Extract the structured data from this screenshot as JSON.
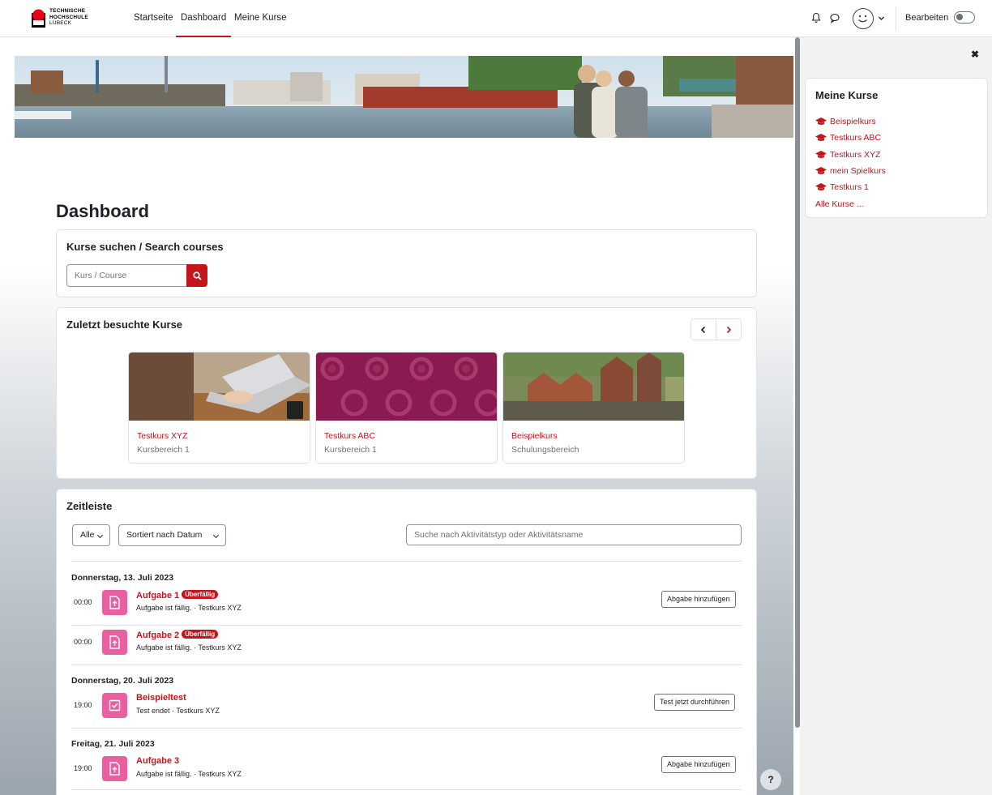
{
  "header": {
    "logo": {
      "line1": "TECHNISCHE",
      "line2": "HOCHSCHULE",
      "line3": "LÜBECK"
    },
    "nav": [
      "Startseite",
      "Dashboard",
      "Meine Kurse"
    ],
    "active_nav": "Dashboard",
    "edit_label": "Bearbeiten",
    "icons": [
      "bell-icon",
      "chat-icon",
      "user-avatar",
      "chevron-down-icon"
    ]
  },
  "page": {
    "title": "Dashboard"
  },
  "search_courses": {
    "title": "Kurse suchen / Search courses",
    "placeholder": "Kurs / Course"
  },
  "recent": {
    "title": "Zuletzt besuchte Kurse",
    "courses": [
      {
        "name": "Testkurs XYZ",
        "category": "Kursbereich 1"
      },
      {
        "name": "Testkurs ABC",
        "category": "Kursbereich 1"
      },
      {
        "name": "Beispielkurs",
        "category": "Schulungsbereich"
      }
    ]
  },
  "timeline": {
    "title": "Zeitleiste",
    "filter": "Alle",
    "sort": "Sortiert nach Datum",
    "search_placeholder": "Suche nach Aktivitätstyp oder Aktivitätsname",
    "groups": [
      {
        "date": "Donnerstag, 13. Juli 2023"
      },
      {
        "date": "Donnerstag, 20. Juli 2023"
      },
      {
        "date": "Freitag, 21. Juli 2023"
      }
    ],
    "items": [
      {
        "time": "00:00",
        "name": "Aufgabe 1",
        "badge": "Überfällig",
        "sub": "Aufgabe ist fällig. · Testkurs XYZ",
        "action": "Abgabe hinzufügen"
      },
      {
        "time": "00:00",
        "name": "Aufgabe 2",
        "badge": "Überfällig",
        "sub": "Aufgabe ist fällig. · Testkurs XYZ",
        "action": ""
      },
      {
        "time": "19:00",
        "name": "Beispieltest",
        "badge": "",
        "sub": "Test endet · Testkurs XYZ",
        "action": "Test jetzt durchführen"
      },
      {
        "time": "19:00",
        "name": "Aufgabe 3",
        "badge": "",
        "sub": "Aufgabe ist fällig. · Testkurs XYZ",
        "action": "Abgabe hinzufügen"
      }
    ]
  },
  "drawer": {
    "title": "Meine Kurse",
    "courses": [
      "Beispielkurs",
      "Testkurs ABC",
      "Testkurs XYZ",
      "mein Spielkurs",
      "Testkurs 1"
    ],
    "all_link": "Alle Kurse ..."
  },
  "help": "?",
  "colors": {
    "accent": "#c4151c",
    "activity_icon": "#e8609f"
  }
}
